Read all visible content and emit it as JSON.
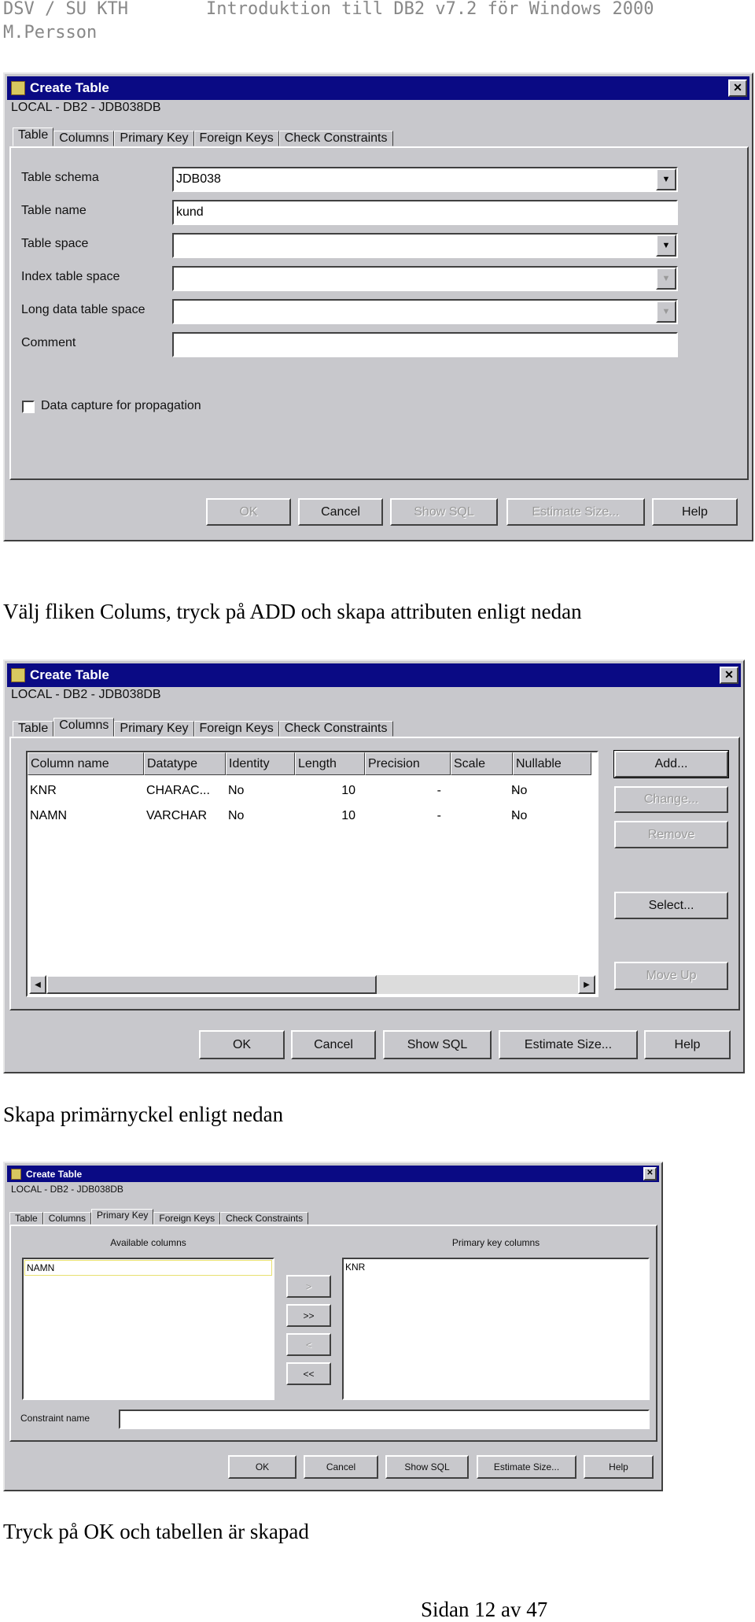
{
  "header": {
    "left": "DSV / SU KTH",
    "right": "Introduktion till DB2 v7.2 för Windows 2000",
    "author": "M.Persson"
  },
  "dialog_title": "Create Table",
  "subtitle": "LOCAL - DB2 - JDB038DB",
  "tabs": [
    "Table",
    "Columns",
    "Primary Key",
    "Foreign Keys",
    "Check Constraints"
  ],
  "buttons": {
    "ok": "OK",
    "cancel": "Cancel",
    "show_sql": "Show SQL",
    "estimate": "Estimate Size...",
    "help": "Help"
  },
  "dialog1": {
    "fields": [
      {
        "label": "Table schema",
        "value": "JDB038",
        "dropdown": true
      },
      {
        "label": "Table name",
        "value": "kund",
        "dropdown": false
      },
      {
        "label": "Table space",
        "value": "",
        "dropdown": true
      },
      {
        "label": "Index table space",
        "value": "",
        "dropdown": true
      },
      {
        "label": "Long data table space",
        "value": "",
        "dropdown": true
      },
      {
        "label": "Comment",
        "value": "",
        "dropdown": false
      }
    ],
    "checkbox": "Data capture for propagation",
    "checked": false
  },
  "caption1": "Välj fliken Colums, tryck på ADD och skapa attributen enligt nedan",
  "dialog2": {
    "columns": [
      "Column name",
      "Datatype",
      "Identity",
      "Length",
      "Precision",
      "Scale",
      "Nullable"
    ],
    "rows": [
      [
        "KNR",
        "CHARAC...",
        "No",
        "10",
        "-",
        "-",
        "No"
      ],
      [
        "NAMN",
        "VARCHAR",
        "No",
        "10",
        "-",
        "-",
        "No"
      ]
    ],
    "side_buttons": {
      "add": "Add...",
      "change": "Change...",
      "remove": "Remove",
      "select": "Select...",
      "move_up": "Move Up"
    }
  },
  "caption2": "Skapa primärnyckel enligt nedan",
  "dialog3": {
    "available_label": "Available columns",
    "pk_label": "Primary key columns",
    "available": [
      "NAMN"
    ],
    "pk": [
      "KNR"
    ],
    "arrows": [
      ">",
      ">>",
      "<",
      "<<"
    ],
    "constraint_label": "Constraint name",
    "constraint_value": ""
  },
  "caption3": "Tryck på OK och tabellen är skapad",
  "footer": "Sidan 12 av 47"
}
